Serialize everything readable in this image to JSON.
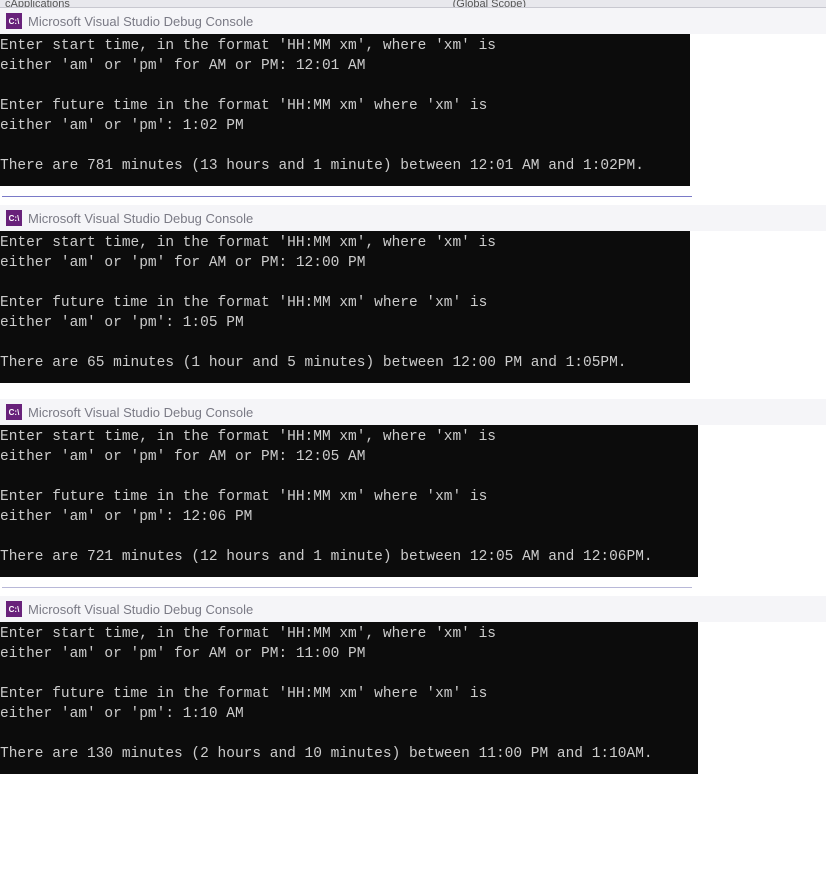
{
  "top_bar": {
    "left": "cApplications",
    "right": "(Global Scope)"
  },
  "window_title": "Microsoft Visual Studio Debug Console",
  "icon_label": "C:\\",
  "consoles": [
    {
      "lines": "Enter start time, in the format 'HH:MM xm', where 'xm' is\neither 'am' or 'pm' for AM or PM: 12:01 AM\n\nEnter future time in the format 'HH:MM xm' where 'xm' is\neither 'am' or 'pm': 1:02 PM\n\nThere are 781 minutes (13 hours and 1 minute) between 12:01 AM and 1:02PM."
    },
    {
      "lines": "Enter start time, in the format 'HH:MM xm', where 'xm' is\neither 'am' or 'pm' for AM or PM: 12:00 PM\n\nEnter future time in the format 'HH:MM xm' where 'xm' is\neither 'am' or 'pm': 1:05 PM\n\nThere are 65 minutes (1 hour and 5 minutes) between 12:00 PM and 1:05PM."
    },
    {
      "lines": "Enter start time, in the format 'HH:MM xm', where 'xm' is\neither 'am' or 'pm' for AM or PM: 12:05 AM\n\nEnter future time in the format 'HH:MM xm' where 'xm' is\neither 'am' or 'pm': 12:06 PM\n\nThere are 721 minutes (12 hours and 1 minute) between 12:05 AM and 12:06PM."
    },
    {
      "lines": "Enter start time, in the format 'HH:MM xm', where 'xm' is\neither 'am' or 'pm' for AM or PM: 11:00 PM\n\nEnter future time in the format 'HH:MM xm' where 'xm' is\neither 'am' or 'pm': 1:10 AM\n\nThere are 130 minutes (2 hours and 10 minutes) between 11:00 PM and 1:10AM."
    }
  ]
}
